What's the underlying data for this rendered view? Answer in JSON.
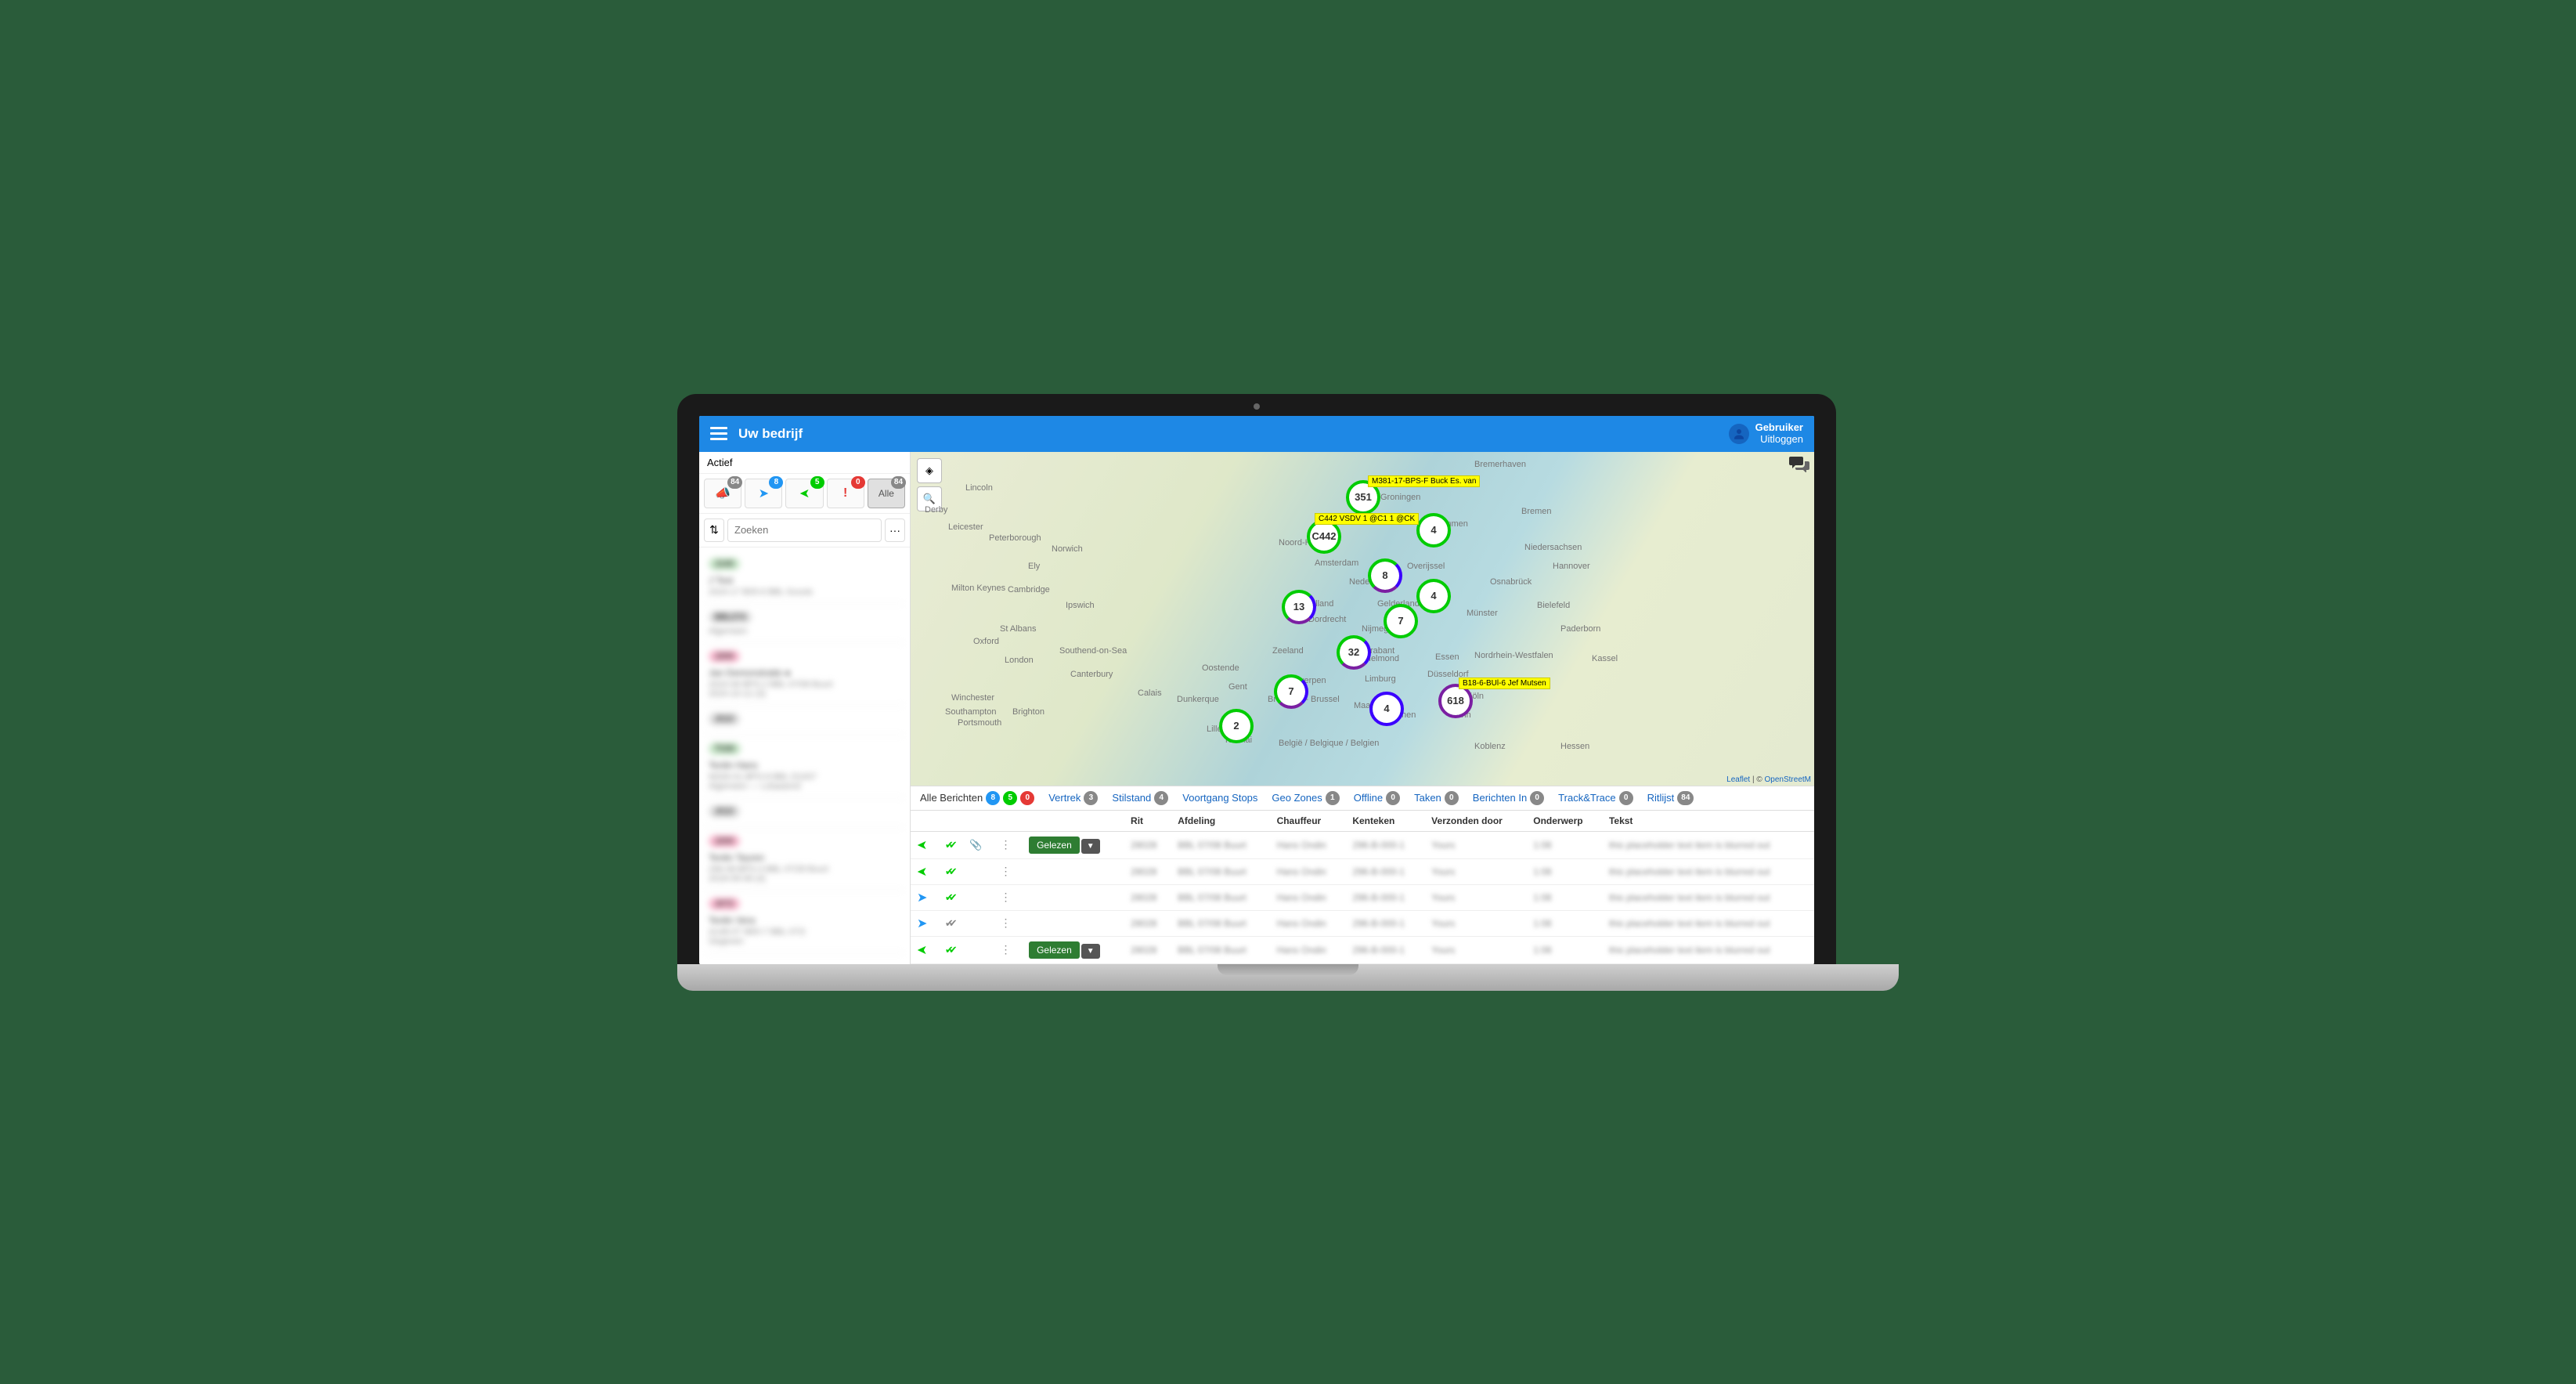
{
  "header": {
    "company": "Uw bedrijf",
    "user_name": "Gebruiker",
    "logout": "Uitloggen"
  },
  "sidebar": {
    "status_label": "Actief",
    "filters": {
      "megaphone_count": "84",
      "send_count": "8",
      "receive_count": "5",
      "alert_count": "0",
      "all_label": "Alle",
      "all_count": "84"
    },
    "search_placeholder": "Zoeken"
  },
  "map": {
    "attribution_leaflet": "Leaflet",
    "attribution_sep": " | © ",
    "attribution_osm": "OpenStreetM",
    "clusters": [
      {
        "id": "c1",
        "label": "351",
        "top": "40",
        "left": "560",
        "ring": "ring-green"
      },
      {
        "id": "c2",
        "label": "4",
        "top": "82",
        "left": "650",
        "ring": "ring-green"
      },
      {
        "id": "c3",
        "label": "C442",
        "top": "90",
        "left": "510",
        "ring": "ring-green"
      },
      {
        "id": "c4",
        "label": "8",
        "top": "140",
        "left": "588",
        "ring": "ring-mix"
      },
      {
        "id": "c5",
        "label": "4",
        "top": "166",
        "left": "650",
        "ring": "ring-green"
      },
      {
        "id": "c6",
        "label": "13",
        "top": "180",
        "left": "478",
        "ring": "ring-mix"
      },
      {
        "id": "c7",
        "label": "7",
        "top": "198",
        "left": "608",
        "ring": "ring-green"
      },
      {
        "id": "c8",
        "label": "32",
        "top": "238",
        "left": "548",
        "ring": "ring-mix"
      },
      {
        "id": "c9",
        "label": "7",
        "top": "288",
        "left": "468",
        "ring": "ring-mix"
      },
      {
        "id": "c10",
        "label": "4",
        "top": "310",
        "left": "590",
        "ring": "ring-blue"
      },
      {
        "id": "c11",
        "label": "618",
        "top": "300",
        "left": "678",
        "ring": "ring-purple"
      },
      {
        "id": "c12",
        "label": "2",
        "top": "332",
        "left": "398",
        "ring": "ring-green"
      }
    ],
    "tags": [
      {
        "text": "M381-17-BPS-F Buck Es. van",
        "top": "30",
        "left": "584"
      },
      {
        "text": "C442 VSDV 1 @C1 1 @CK",
        "top": "78",
        "left": "516"
      },
      {
        "text": "B18-6-BUl-6 Jef Mutsen",
        "top": "288",
        "left": "700"
      }
    ],
    "cities": [
      {
        "name": "Lincoln",
        "top": "40",
        "left": "70"
      },
      {
        "name": "Bremerhaven",
        "top": "10",
        "left": "720"
      },
      {
        "name": "Groningen",
        "top": "52",
        "left": "600"
      },
      {
        "name": "Bremen",
        "top": "70",
        "left": "780"
      },
      {
        "name": "Emmen",
        "top": "86",
        "left": "674"
      },
      {
        "name": "Niedersachsen",
        "top": "116",
        "left": "784"
      },
      {
        "name": "Noord-Holland",
        "top": "110",
        "left": "470"
      },
      {
        "name": "Amsterdam",
        "top": "136",
        "left": "516"
      },
      {
        "name": "Overijssel",
        "top": "140",
        "left": "634"
      },
      {
        "name": "Hannover",
        "top": "140",
        "left": "820"
      },
      {
        "name": "Nederland",
        "top": "160",
        "left": "560"
      },
      {
        "name": "Osnabrück",
        "top": "160",
        "left": "740"
      },
      {
        "name": "Bielefeld",
        "top": "190",
        "left": "800"
      },
      {
        "name": "Zuid-Holland",
        "top": "188",
        "left": "478"
      },
      {
        "name": "Gelderland",
        "top": "188",
        "left": "596"
      },
      {
        "name": "Münster",
        "top": "200",
        "left": "710"
      },
      {
        "name": "Paderborn",
        "top": "220",
        "left": "830"
      },
      {
        "name": "Dordrecht",
        "top": "208",
        "left": "508"
      },
      {
        "name": "Nijmegen",
        "top": "220",
        "left": "576"
      },
      {
        "name": "Oxford",
        "top": "236",
        "left": "80"
      },
      {
        "name": "London",
        "top": "260",
        "left": "120"
      },
      {
        "name": "Zeeland",
        "top": "248",
        "left": "462"
      },
      {
        "name": "Noord-Brabant",
        "top": "248",
        "left": "546"
      },
      {
        "name": "Helmond",
        "top": "258",
        "left": "580"
      },
      {
        "name": "Essen",
        "top": "256",
        "left": "670"
      },
      {
        "name": "Nordrhein-Westfalen",
        "top": "254",
        "left": "720"
      },
      {
        "name": "Kassel",
        "top": "258",
        "left": "870"
      },
      {
        "name": "Canterbury",
        "top": "278",
        "left": "204"
      },
      {
        "name": "Oostende",
        "top": "270",
        "left": "372"
      },
      {
        "name": "Gent",
        "top": "294",
        "left": "406"
      },
      {
        "name": "Antwerpen",
        "top": "286",
        "left": "478"
      },
      {
        "name": "Limburg",
        "top": "284",
        "left": "580"
      },
      {
        "name": "Düsseldorf",
        "top": "278",
        "left": "660"
      },
      {
        "name": "Köln",
        "top": "306",
        "left": "710"
      },
      {
        "name": "Calais",
        "top": "302",
        "left": "290"
      },
      {
        "name": "Dunkerque",
        "top": "310",
        "left": "340"
      },
      {
        "name": "Bruxelles - Brussel",
        "top": "310",
        "left": "456"
      },
      {
        "name": "Maastricht",
        "top": "318",
        "left": "566"
      },
      {
        "name": "Aachen",
        "top": "330",
        "left": "608"
      },
      {
        "name": "Bonn",
        "top": "330",
        "left": "690"
      },
      {
        "name": "Brighton",
        "top": "326",
        "left": "130"
      },
      {
        "name": "Lille",
        "top": "348",
        "left": "378"
      },
      {
        "name": "Tournai",
        "top": "362",
        "left": "400"
      },
      {
        "name": "België / Belgique / Belgien",
        "top": "366",
        "left": "470"
      },
      {
        "name": "Koblenz",
        "top": "370",
        "left": "720"
      },
      {
        "name": "Hessen",
        "top": "370",
        "left": "830"
      },
      {
        "name": "Norwich",
        "top": "118",
        "left": "180"
      },
      {
        "name": "Cambridge",
        "top": "170",
        "left": "124"
      },
      {
        "name": "Ipswich",
        "top": "190",
        "left": "198"
      },
      {
        "name": "Leicester",
        "top": "90",
        "left": "48"
      },
      {
        "name": "Peterborough",
        "top": "104",
        "left": "100"
      },
      {
        "name": "Milton Keynes",
        "top": "168",
        "left": "52"
      },
      {
        "name": "Ely",
        "top": "140",
        "left": "150"
      },
      {
        "name": "Derby",
        "top": "68",
        "left": "18"
      },
      {
        "name": "St Albans",
        "top": "220",
        "left": "114"
      },
      {
        "name": "Southend-on-Sea",
        "top": "248",
        "left": "190"
      },
      {
        "name": "Winchester",
        "top": "308",
        "left": "52"
      },
      {
        "name": "Southampton",
        "top": "326",
        "left": "44"
      },
      {
        "name": "Portsmouth",
        "top": "340",
        "left": "60"
      }
    ]
  },
  "tabs": [
    {
      "label": "Alle Berichten",
      "counts": [
        {
          "c": "p-blue",
          "v": "8"
        },
        {
          "c": "p-green",
          "v": "5"
        },
        {
          "c": "p-red",
          "v": "0"
        }
      ],
      "active": true
    },
    {
      "label": "Vertrek",
      "counts": [
        {
          "c": "p-gray",
          "v": "3"
        }
      ]
    },
    {
      "label": "Stilstand",
      "counts": [
        {
          "c": "p-gray",
          "v": "4"
        }
      ]
    },
    {
      "label": "Voortgang Stops",
      "counts": []
    },
    {
      "label": "Geo Zones",
      "counts": [
        {
          "c": "p-gray",
          "v": "1"
        }
      ]
    },
    {
      "label": "Offline",
      "counts": [
        {
          "c": "p-gray",
          "v": "0"
        }
      ]
    },
    {
      "label": "Taken",
      "counts": [
        {
          "c": "p-gray",
          "v": "0"
        }
      ]
    },
    {
      "label": "Berichten In",
      "counts": [
        {
          "c": "p-gray",
          "v": "0"
        }
      ]
    },
    {
      "label": "Track&Trace",
      "counts": [
        {
          "c": "p-gray",
          "v": "0"
        }
      ]
    },
    {
      "label": "Ritlijst",
      "counts": [
        {
          "c": "p-gray",
          "v": "84"
        }
      ]
    }
  ],
  "table": {
    "headers": [
      "",
      "",
      "",
      "",
      "",
      "Rit",
      "Afdeling",
      "Chauffeur",
      "Kenteken",
      "Verzonden door",
      "Onderwerp",
      "Tekst"
    ],
    "gelezen_label": "Gelezen",
    "rows": [
      {
        "dir": "in",
        "check": "green",
        "clip": true,
        "gelezen": true
      },
      {
        "dir": "in",
        "check": "green",
        "clip": false,
        "gelezen": false
      },
      {
        "dir": "out",
        "check": "green",
        "clip": false,
        "gelezen": false
      },
      {
        "dir": "out",
        "check": "gray",
        "clip": false,
        "gelezen": false
      },
      {
        "dir": "in",
        "check": "green",
        "clip": false,
        "gelezen": true
      }
    ]
  }
}
